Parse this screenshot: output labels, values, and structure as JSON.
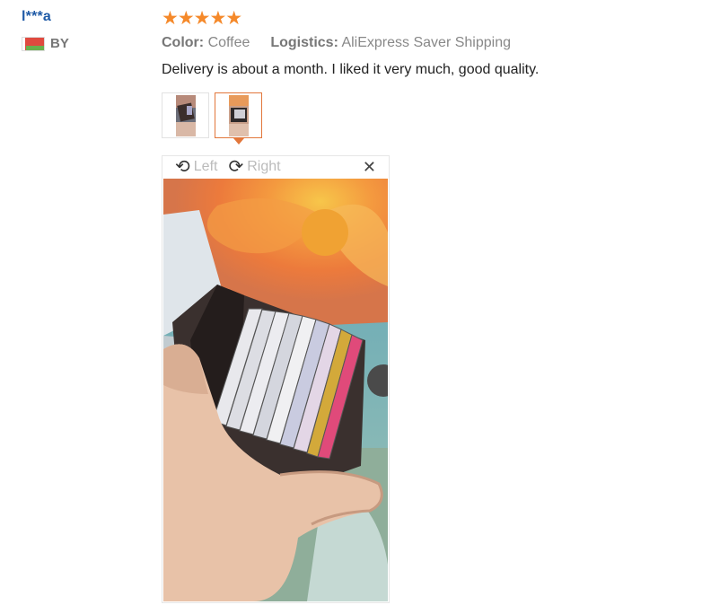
{
  "reviewer": {
    "name": "l***a",
    "country_code": "BY",
    "flag_icon": "belarus-flag-icon"
  },
  "review": {
    "rating": 5,
    "stars": "★★★★★",
    "color_label": "Color:",
    "color_value": "Coffee",
    "logistics_label": "Logistics:",
    "logistics_value": "AliExpress Saver Shipping",
    "text": "Delivery is about a month. I liked it very much, good quality."
  },
  "thumbnails": {
    "count": 2,
    "selected_index": 1
  },
  "viewer": {
    "rotate_left_label": "Left",
    "rotate_right_label": "Right",
    "close_icon": "close-icon",
    "accent_color": "#e2773b"
  }
}
